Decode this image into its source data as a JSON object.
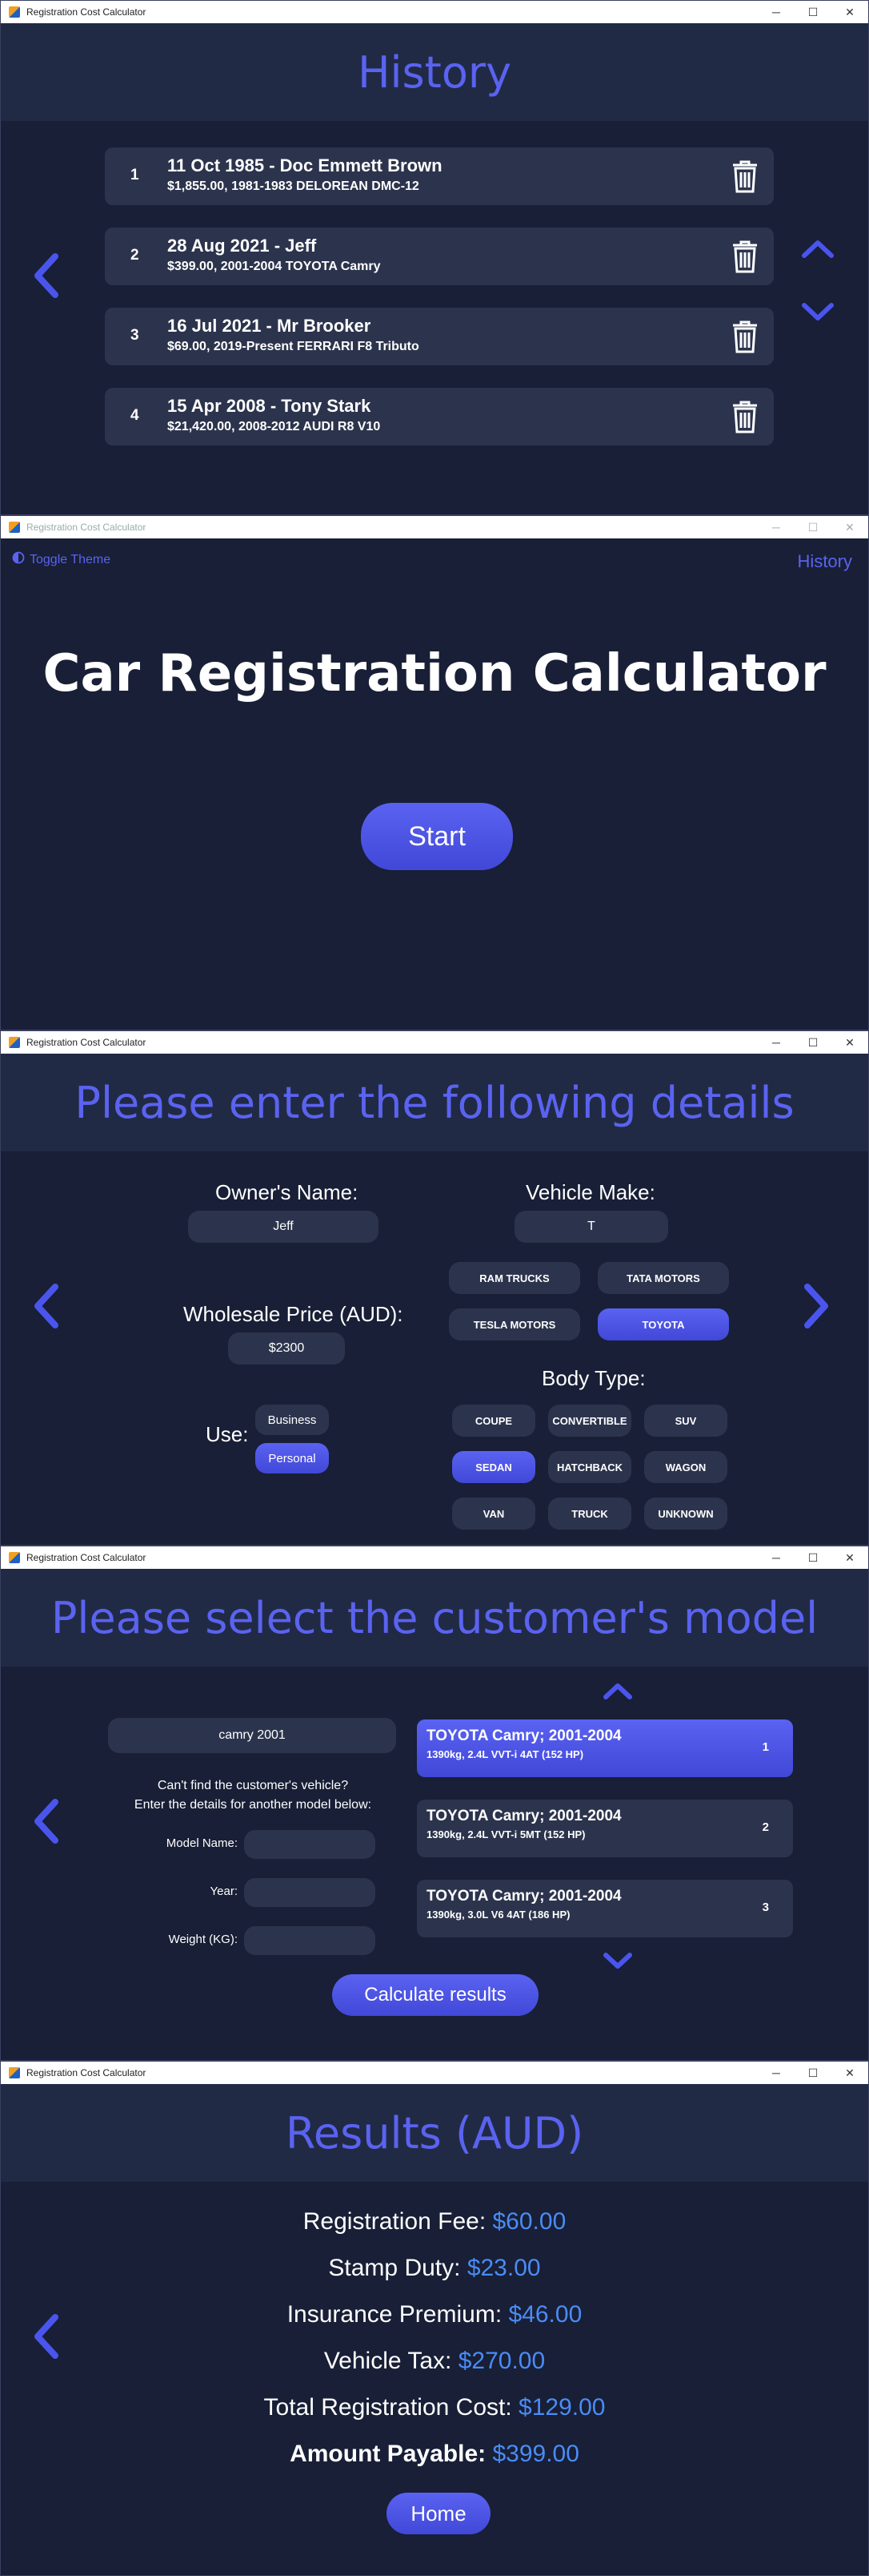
{
  "app_title": "Registration Cost Calculator",
  "window_controls": {
    "minimize": "─",
    "maximize": "☐",
    "close": "✕"
  },
  "history": {
    "title": "History",
    "items": [
      {
        "num": "1",
        "line1": "11 Oct 1985 - Doc Emmett Brown",
        "line2": "$1,855.00, 1981-1983 DELOREAN DMC-12"
      },
      {
        "num": "2",
        "line1": "28 Aug 2021 - Jeff",
        "line2": "$399.00, 2001-2004 TOYOTA Camry"
      },
      {
        "num": "3",
        "line1": "16 Jul 2021 - Mr Brooker",
        "line2": "$69.00, 2019-Present FERRARI F8 Tributo"
      },
      {
        "num": "4",
        "line1": "15 Apr 2008 - Tony Stark",
        "line2": "$21,420.00, 2008-2012 AUDI R8 V10"
      }
    ]
  },
  "welcome": {
    "toggle_theme": "Toggle Theme",
    "history_link": "History",
    "title": "Car Registration Calculator",
    "start": "Start"
  },
  "details": {
    "title": "Please enter the following details",
    "owner_label": "Owner's Name:",
    "owner_value": "Jeff",
    "make_label": "Vehicle Make:",
    "make_value": "T",
    "makes": [
      "RAM TRUCKS",
      "TATA MOTORS",
      "TESLA MOTORS",
      "TOYOTA"
    ],
    "price_label": "Wholesale Price (AUD):",
    "price_value": "$2300",
    "use_label": "Use:",
    "use_options": [
      "Business",
      "Personal"
    ],
    "body_label": "Body Type:",
    "body_types": [
      "COUPE",
      "CONVERTIBLE",
      "SUV",
      "SEDAN",
      "HATCHBACK",
      "WAGON",
      "VAN",
      "TRUCK",
      "UNKNOWN"
    ]
  },
  "model": {
    "title": "Please select the customer's model",
    "search_value": "camry 2001",
    "help1": "Can't find the customer's vehicle?",
    "help2": "Enter the details for another model below:",
    "model_name_label": "Model Name:",
    "year_label": "Year:",
    "weight_label": "Weight (KG):",
    "cards": [
      {
        "title": "TOYOTA Camry; 2001-2004",
        "spec": "1390kg, 2.4L VVT-i 4AT (152 HP)",
        "num": "1"
      },
      {
        "title": "TOYOTA Camry; 2001-2004",
        "spec": "1390kg, 2.4L VVT-i 5MT (152 HP)",
        "num": "2"
      },
      {
        "title": "TOYOTA Camry; 2001-2004",
        "spec": "1390kg, 3.0L V6 4AT (186 HP)",
        "num": "3"
      }
    ],
    "calculate": "Calculate results"
  },
  "results": {
    "title": "Results (AUD)",
    "lines": [
      {
        "label": "Registration Fee: ",
        "value": "$60.00"
      },
      {
        "label": "Stamp Duty: ",
        "value": "$23.00"
      },
      {
        "label": "Insurance Premium: ",
        "value": "$46.00"
      },
      {
        "label": "Vehicle Tax: ",
        "value": "$270.00"
      },
      {
        "label": "Total Registration Cost: ",
        "value": "$129.00"
      },
      {
        "label": "Amount Payable: ",
        "value": "$399.00"
      }
    ],
    "home": "Home"
  },
  "colors": {
    "accent": "#5a63f0",
    "bg": "#181f36",
    "card": "#2c344d",
    "value": "#4a8cf5"
  }
}
